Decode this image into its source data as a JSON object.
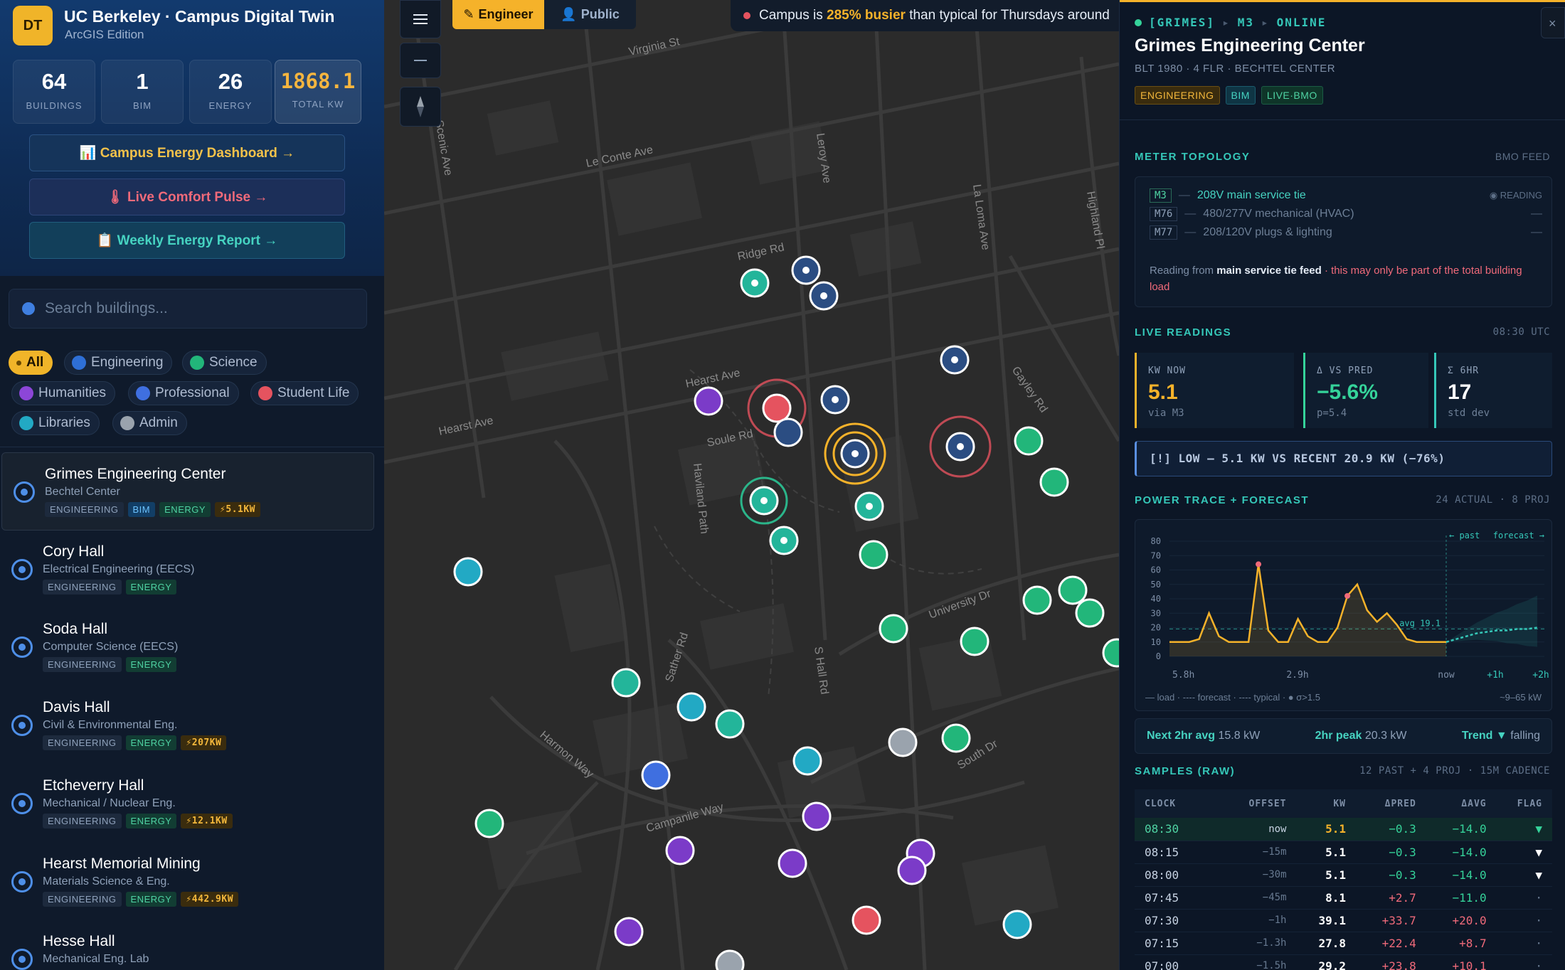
{
  "app": {
    "logo": "DT",
    "title": "UC Berkeley · Campus Digital Twin",
    "subtitle": "ArcGIS Edition"
  },
  "stats": [
    {
      "value": "64",
      "label": "BUILDINGS"
    },
    {
      "value": "1",
      "label": "BIM"
    },
    {
      "value": "26",
      "label": "ENERGY"
    },
    {
      "value": "1868.1",
      "label": "TOTAL KW"
    }
  ],
  "links": {
    "energy": "📊 Campus Energy Dashboard →",
    "comfort": "🌡 Live Comfort Pulse →",
    "report": "📋 Weekly Energy Report →"
  },
  "search": {
    "placeholder": "Search buildings..."
  },
  "filters": {
    "all": "All",
    "engineering": "Engineering",
    "science": "Science",
    "humanities": "Humanities",
    "professional": "Professional",
    "student_life": "Student Life",
    "libraries": "Libraries",
    "admin": "Admin"
  },
  "buildings": [
    {
      "name": "Grimes Engineering Center",
      "sub": "Bechtel Center",
      "tags": [
        "ENGINEERING",
        "BIM",
        "ENERGY"
      ],
      "kw": "⚡5.1KW"
    },
    {
      "name": "Cory Hall",
      "sub": "Electrical Engineering (EECS)",
      "tags": [
        "ENGINEERING",
        "ENERGY"
      ],
      "kw": ""
    },
    {
      "name": "Soda Hall",
      "sub": "Computer Science (EECS)",
      "tags": [
        "ENGINEERING",
        "ENERGY"
      ],
      "kw": ""
    },
    {
      "name": "Davis Hall",
      "sub": "Civil & Environmental Eng.",
      "tags": [
        "ENGINEERING",
        "ENERGY"
      ],
      "kw": "⚡207KW"
    },
    {
      "name": "Etcheverry Hall",
      "sub": "Mechanical / Nuclear Eng.",
      "tags": [
        "ENGINEERING",
        "ENERGY"
      ],
      "kw": "⚡12.1KW"
    },
    {
      "name": "Hearst Memorial Mining",
      "sub": "Materials Science & Eng.",
      "tags": [
        "ENGINEERING",
        "ENERGY"
      ],
      "kw": "⚡442.9KW"
    },
    {
      "name": "Hesse Hall",
      "sub": "Mechanical Eng. Lab",
      "tags": [],
      "kw": ""
    }
  ],
  "map": {
    "mode_engineer": "Engineer",
    "mode_public": "Public",
    "alert_pre": "Campus is ",
    "alert_hl": "285% busier",
    "alert_post": " than typical for Thursdays around",
    "streets": {
      "virginia": "Virginia St",
      "leconte": "Le Conte Ave",
      "ridge": "Ridge Rd",
      "hearst1": "Hearst Ave",
      "hearst2": "Hearst Ave",
      "soule": "Soule Rd",
      "scenic": "Scenic Ave",
      "leroy": "Leroy Ave",
      "laloma": "La Loma Ave",
      "highland": "Highland Pl",
      "gayley": "Gayley Rd",
      "haviland": "Haviland Path",
      "university": "University Dr",
      "sather": "Sather Rd",
      "shall": "S Hall Rd",
      "harmon": "Harmon Way",
      "campanile": "Campanile Way",
      "south": "South Dr"
    }
  },
  "detail": {
    "crumb_id": "[GRIMES]",
    "crumb_meter": "M3",
    "crumb_status": "ONLINE",
    "title": "Grimes Engineering Center",
    "meta": "BLT 1980 · 4 FLR · BECHTEL CENTER",
    "badges": [
      "ENGINEERING",
      "BIM",
      "LIVE·BMO"
    ],
    "topology_h": "METER TOPOLOGY",
    "topology_r": "BMO FEED",
    "meters": [
      {
        "id": "M3",
        "desc": "208V main service tie",
        "status": "◉ READING"
      },
      {
        "id": "M76",
        "desc": "480/277V mechanical (HVAC)",
        "status": "—"
      },
      {
        "id": "M77",
        "desc": "208/120V plugs & lighting",
        "status": "—"
      }
    ],
    "note_pre": "Reading from ",
    "note_b": "main service tie feed",
    "note_warn": " · this may only be part of the total building load",
    "live_h": "LIVE READINGS",
    "live_r": "08:30 UTC",
    "cards": [
      {
        "label": "KW NOW",
        "value": "5.1",
        "sub": "via M3",
        "color": "#f5b22a"
      },
      {
        "label": "Δ VS PRED",
        "value": "−5.6%",
        "sub": "p=5.4",
        "color": "#35d39a"
      },
      {
        "label": "Σ 6HR",
        "value": "17",
        "sub": "std dev",
        "color": "#ffffff"
      }
    ],
    "flag": "[!] LOW — 5.1 KW VS RECENT 20.9 KW (−76%)",
    "trace_h": "POWER TRACE + FORECAST",
    "trace_r": "24 ACTUAL · 8 PROJ",
    "legend": "— load · ---- forecast · ---- typical · ● σ>1.5",
    "range": "~9–65 kW",
    "next_avg_l": "Next 2hr avg",
    "next_avg_v": "15.8 kW",
    "peak_l": "2hr peak",
    "peak_v": "20.3 kW",
    "trend_l": "Trend ▼",
    "trend_v": "falling",
    "samples_h": "SAMPLES (RAW)",
    "samples_r": "12 PAST + 4 PROJ · 15M CADENCE",
    "cols": [
      "CLOCK",
      "OFFSET",
      "KW",
      "ΔPRED",
      "ΔAVG",
      "FLAG"
    ],
    "rows": [
      [
        "08:30",
        "now",
        "5.1",
        "−0.3",
        "−14.0",
        "▼"
      ],
      [
        "08:15",
        "−15m",
        "5.1",
        "−0.3",
        "−14.0",
        "▼"
      ],
      [
        "08:00",
        "−30m",
        "5.1",
        "−0.3",
        "−14.0",
        "▼"
      ],
      [
        "07:45",
        "−45m",
        "8.1",
        "+2.7",
        "−11.0",
        "·"
      ],
      [
        "07:30",
        "−1h",
        "39.1",
        "+33.7",
        "+20.0",
        "·"
      ],
      [
        "07:15",
        "−1.3h",
        "27.8",
        "+22.4",
        "+8.7",
        "·"
      ],
      [
        "07:00",
        "−1.5h",
        "29.2",
        "+23.8",
        "+10.1",
        "·"
      ]
    ]
  },
  "chart_data": {
    "type": "line",
    "yticks": [
      "80",
      "70",
      "60",
      "50",
      "40",
      "30",
      "20",
      "10",
      "0"
    ],
    "xticks": [
      "5.8h",
      "2.9h",
      "now",
      "+1h",
      "+2h"
    ],
    "ylim": [
      0,
      80
    ],
    "annotations": {
      "past": "← past",
      "forecast": "forecast →",
      "avg": "avg 19.1"
    },
    "series": [
      {
        "values": [
          10,
          10,
          10,
          12,
          30,
          14,
          10,
          10,
          10,
          64,
          18,
          10,
          10,
          26,
          14,
          10,
          10,
          20,
          42,
          50,
          32,
          24,
          30,
          22,
          12,
          10,
          10,
          10,
          10
        ]
      },
      {
        "values": [
          10,
          12,
          14,
          16,
          17,
          18,
          18,
          19,
          19,
          20
        ]
      }
    ],
    "avg": 19.1
  },
  "colors": {
    "accent": "#f5b22a",
    "teal": "#35c7b8",
    "low": "#e5535f"
  }
}
